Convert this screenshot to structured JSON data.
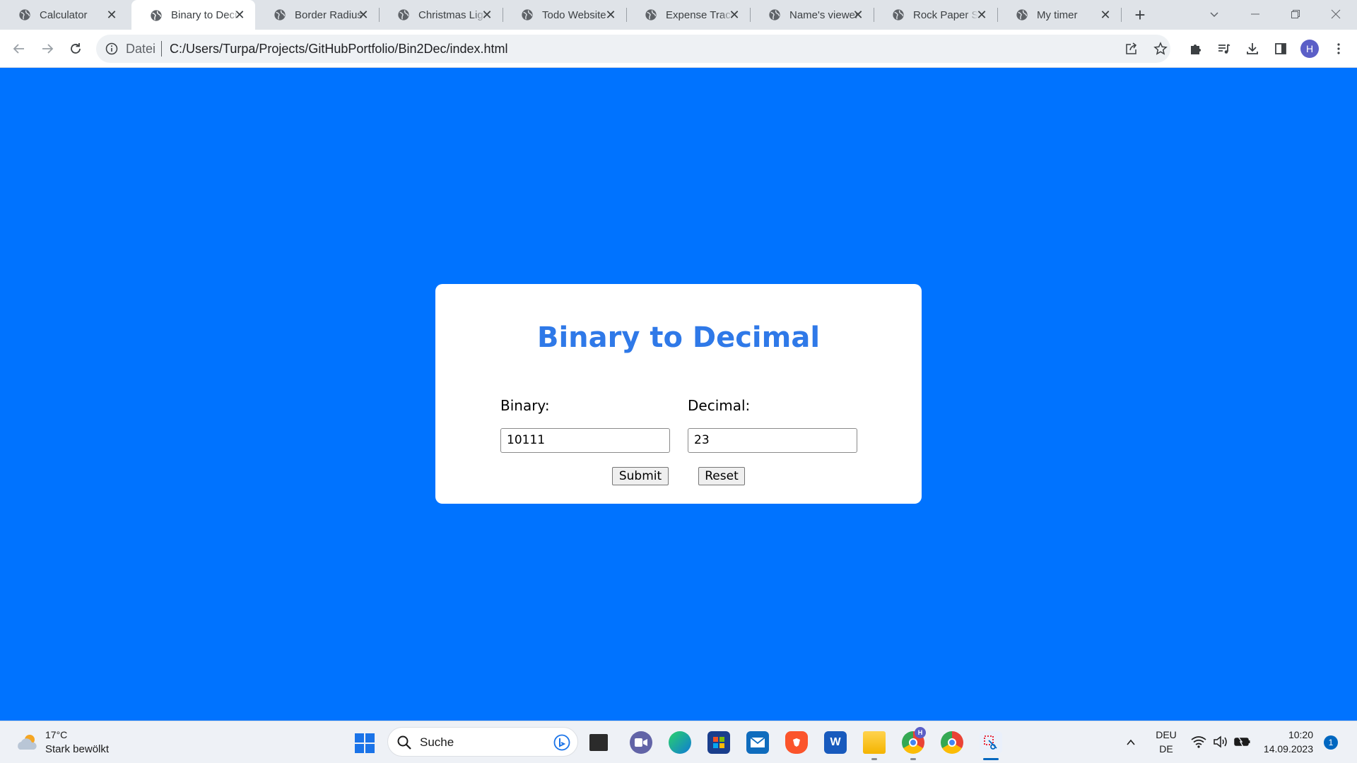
{
  "browser": {
    "tabs": [
      {
        "title": "Calculator",
        "active": false
      },
      {
        "title": "Binary to Decimal",
        "active": true
      },
      {
        "title": "Border Radius",
        "active": false
      },
      {
        "title": "Christmas Lights",
        "active": false
      },
      {
        "title": "Todo Website",
        "active": false
      },
      {
        "title": "Expense Tracker",
        "active": false
      },
      {
        "title": "Name's viewer",
        "active": false
      },
      {
        "title": "Rock Paper Scissors",
        "active": false
      },
      {
        "title": "My timer",
        "active": false
      }
    ],
    "new_tab_label": "+",
    "address": {
      "scheme_label": "Datei",
      "url": "C:/Users/Turpa/Projects/GitHubPortfolio/Bin2Dec/index.html"
    },
    "profile_initial": "H"
  },
  "page": {
    "background": "#0073ff",
    "heading": "Binary to Decimal",
    "heading_color": "#2f79e8",
    "binary_label": "Binary:",
    "binary_value": "10111",
    "decimal_label": "Decimal:",
    "decimal_value": "23",
    "submit_label": "Submit",
    "reset_label": "Reset"
  },
  "taskbar": {
    "weather_temp": "17°C",
    "weather_desc": "Stark bewölkt",
    "search_placeholder": "Suche",
    "apps": [
      "copilot-icon",
      "task-view-icon",
      "teams-icon",
      "edge-icon",
      "store-icon",
      "mail-icon",
      "brave-icon",
      "word-icon",
      "file-explorer-icon",
      "chrome-profile-icon",
      "chrome-icon",
      "snipping-tool-icon"
    ],
    "language_top": "DEU",
    "language_bottom": "DE",
    "time": "10:20",
    "date": "14.09.2023",
    "notification_count": "1"
  }
}
